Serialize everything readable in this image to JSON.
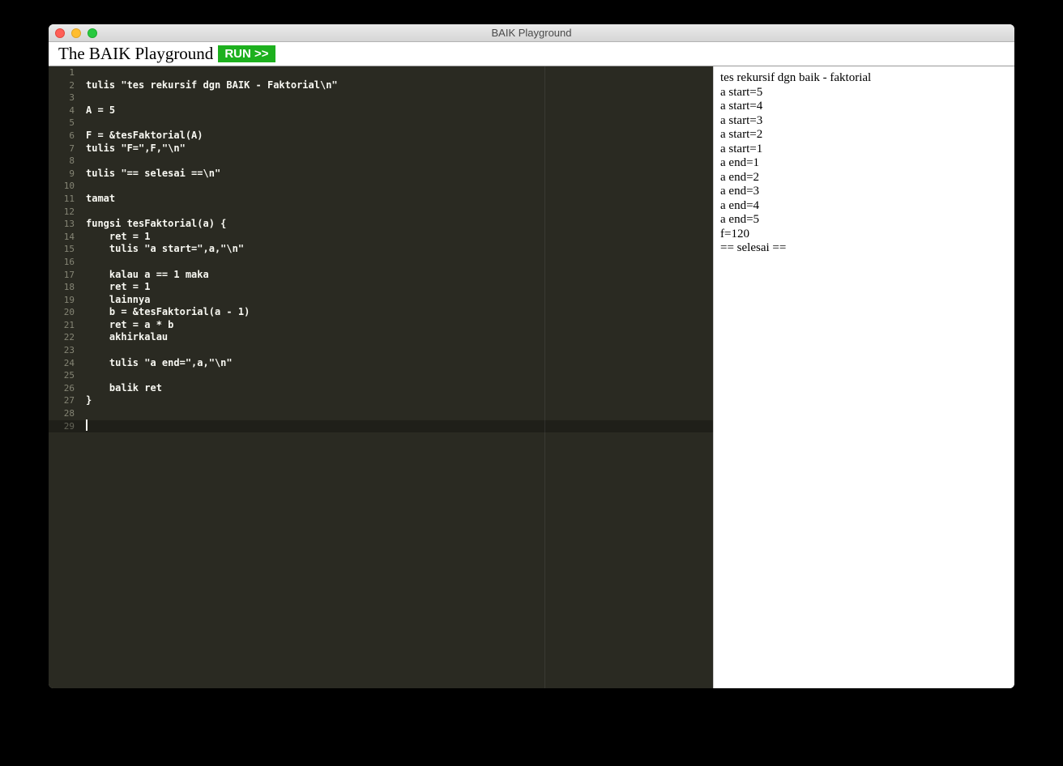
{
  "window": {
    "title": "BAIK Playground"
  },
  "toolbar": {
    "app_title": "The BAIK Playground",
    "run_label": "RUN >>"
  },
  "editor": {
    "line_count": 29,
    "cursor_line": 29,
    "lines": [
      "",
      "tulis \"tes rekursif dgn BAIK - Faktorial\\n\"",
      "",
      "A = 5",
      "",
      "F = &tesFaktorial(A)",
      "tulis \"F=\",F,\"\\n\"",
      "",
      "tulis \"== selesai ==\\n\"",
      "",
      "tamat",
      "",
      "fungsi tesFaktorial(a) {",
      "    ret = 1",
      "    tulis \"a start=\",a,\"\\n\"",
      "",
      "    kalau a == 1 maka",
      "    ret = 1",
      "    lainnya",
      "    b = &tesFaktorial(a - 1)",
      "    ret = a * b",
      "    akhirkalau",
      "",
      "    tulis \"a end=\",a,\"\\n\"",
      "",
      "    balik ret",
      "}",
      "",
      ""
    ]
  },
  "output": {
    "lines": [
      "tes rekursif dgn baik - faktorial",
      "a start=5",
      "a start=4",
      "a start=3",
      "a start=2",
      "a start=1",
      "a end=1",
      "a end=2",
      "a end=3",
      "a end=4",
      "a end=5",
      "f=120",
      "== selesai =="
    ]
  }
}
